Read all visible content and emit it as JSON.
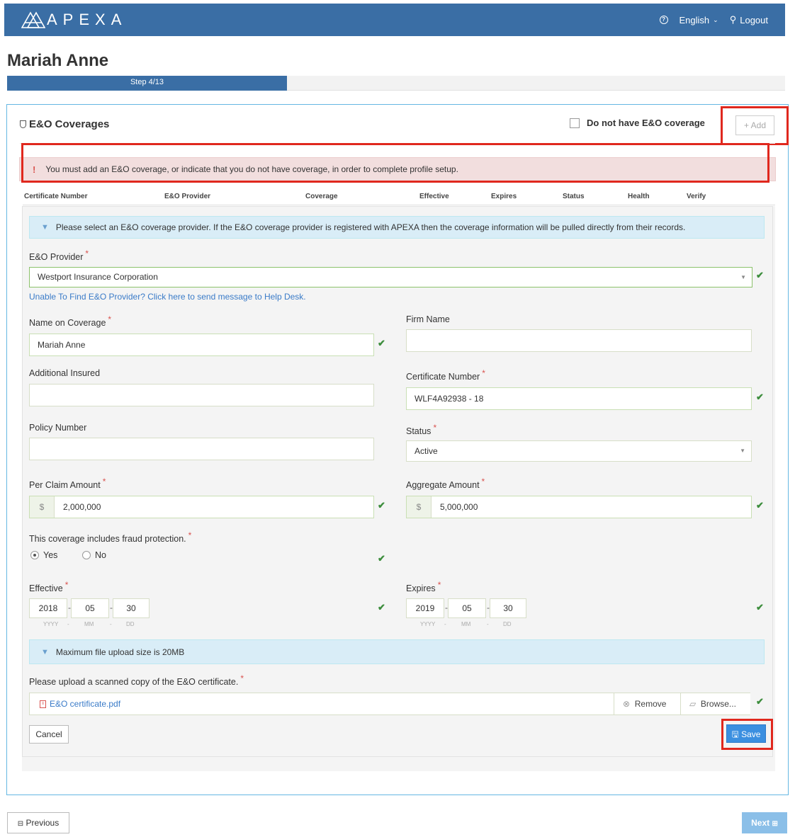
{
  "header": {
    "brand": "APEXA",
    "language": "English",
    "logout": "Logout"
  },
  "page": {
    "title": "Mariah Anne",
    "step": "Step 4/13",
    "progress_fraction": 0.3077
  },
  "panel": {
    "title": "E&O Coverages",
    "no_coverage_label": "Do not have E&O coverage",
    "add_label": "Add"
  },
  "alert_required": "You must add an E&O coverage, or indicate that you do not have coverage, in order to complete profile setup.",
  "table": {
    "columns": [
      "Certificate Number",
      "E&O Provider",
      "Coverage",
      "Effective",
      "Expires",
      "Status",
      "Health",
      "Verify"
    ]
  },
  "form": {
    "provider_info": "Please select an E&O coverage provider. If the E&O coverage provider is registered with APEXA then the coverage information will be pulled directly from their records.",
    "provider_label": "E&O Provider",
    "provider_value": "Westport Insurance Corporation",
    "help_link": "Unable To Find E&O Provider? Click here to send message to Help Desk.",
    "name_label": "Name on Coverage",
    "name_value": "Mariah Anne",
    "firm_label": "Firm Name",
    "firm_value": "",
    "additional_label": "Additional Insured",
    "additional_value": "",
    "cert_label": "Certificate Number",
    "cert_value": "WLF4A92938 - 18",
    "policy_label": "Policy Number",
    "policy_value": "",
    "status_label": "Status",
    "status_value": "Active",
    "per_claim_label": "Per Claim Amount",
    "per_claim_value": "2,000,000",
    "aggregate_label": "Aggregate Amount",
    "aggregate_value": "5,000,000",
    "currency": "$",
    "fraud_label": "This coverage includes fraud protection.",
    "fraud_yes": "Yes",
    "fraud_no": "No",
    "effective_label": "Effective",
    "effective": {
      "yyyy": "2018",
      "mm": "05",
      "dd": "30"
    },
    "expires_label": "Expires",
    "expires": {
      "yyyy": "2019",
      "mm": "05",
      "dd": "30"
    },
    "date_hint": {
      "y": "YYYY",
      "m": "MM",
      "d": "DD"
    },
    "upload_info": "Maximum file upload size is 20MB",
    "upload_label": "Please upload a scanned copy of the E&O certificate.",
    "file_name": "E&O certificate.pdf",
    "remove_label": "Remove",
    "browse_label": "Browse...",
    "cancel_label": "Cancel",
    "save_label": "Save",
    "required_mark": "*"
  },
  "footer": {
    "previous_label": "Previous",
    "next_label": "Next"
  },
  "colors": {
    "brand": "#3a6ea5",
    "highlight": "#e0281e",
    "save": "#3b8fe0",
    "valid": "#3c8d3c"
  }
}
